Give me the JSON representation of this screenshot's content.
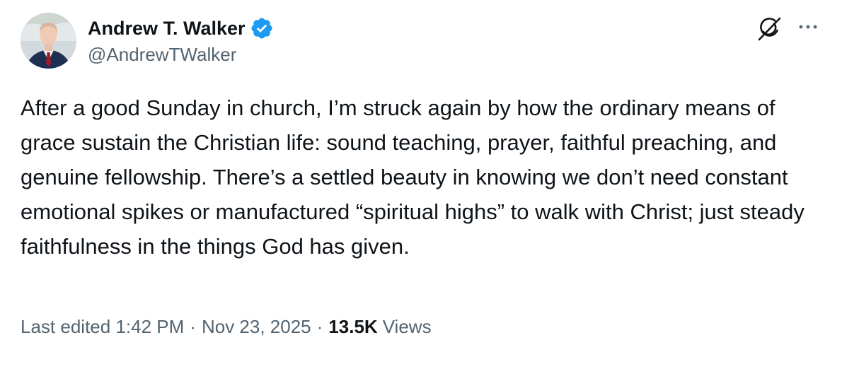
{
  "author": {
    "display_name": "Andrew T. Walker",
    "handle": "@AndrewTWalker",
    "verified": true
  },
  "tweet": {
    "text": "After a good Sunday in church, I’m struck again by how the ordinary means of grace sustain the Christian life: sound teaching, prayer, faithful preaching, and genuine fellowship. There’s a settled beauty in knowing we don’t need constant emotional spikes or manufactured “spiritual highs” to walk with Christ; just steady faithfulness in the things God has given."
  },
  "meta": {
    "edited_label": "Last edited",
    "time": "1:42 PM",
    "separator_1": "·",
    "date": "Nov 23, 2025",
    "separator_2": "·",
    "views_count": "13.5K",
    "views_label": "Views"
  },
  "icons": {
    "verified": "verified-badge-icon",
    "grok": "grok-icon",
    "more": "more-options-icon"
  },
  "colors": {
    "text_primary": "#0f1419",
    "text_secondary": "#536471",
    "verified_blue": "#1d9bf0"
  }
}
